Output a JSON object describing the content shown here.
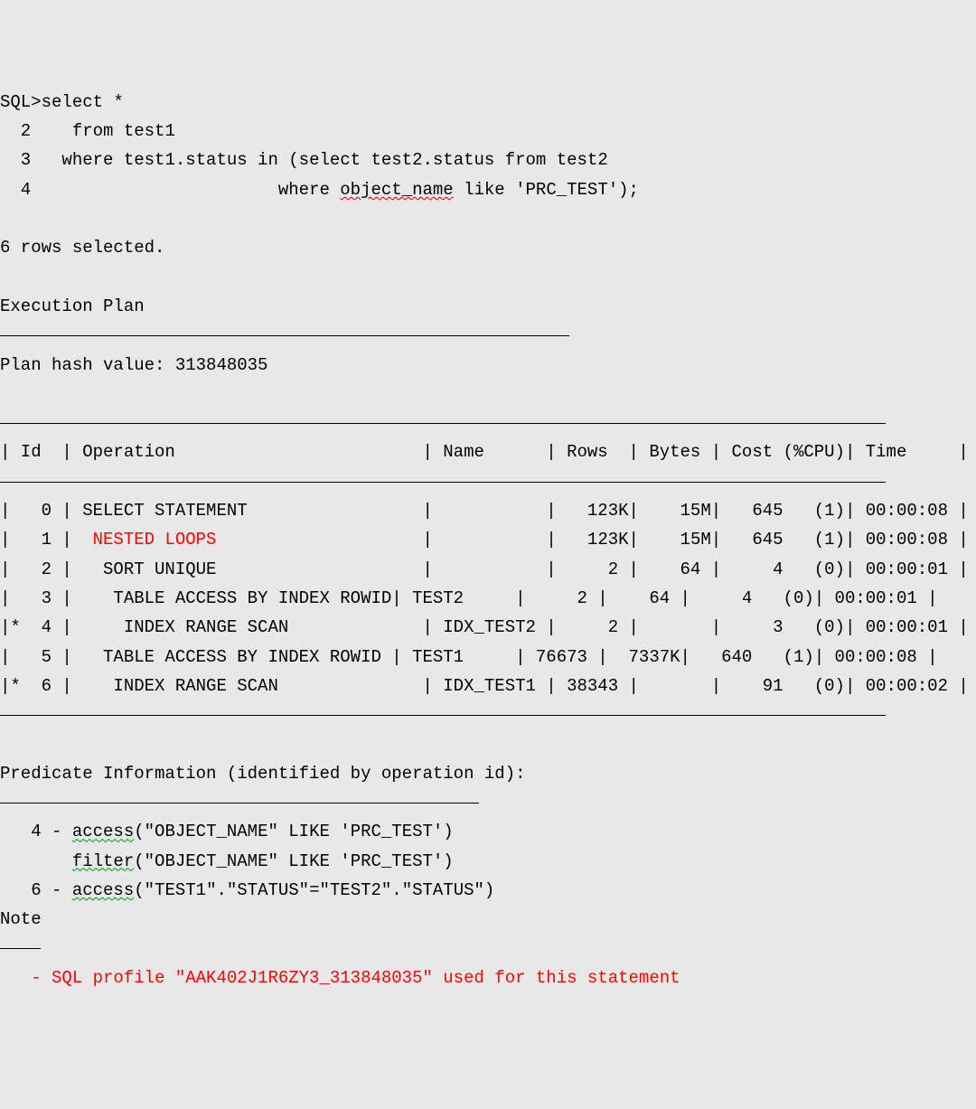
{
  "prompt": "SQL>",
  "sql": {
    "l1": "select *",
    "l2_num": "  2",
    "l2_txt": "    from test1",
    "l3_num": "  3",
    "l3_txt": "   where test1.status in (select test2.status from test2",
    "l4_num": "  4",
    "l4_txt_a": "                        where ",
    "l4_typo": "object_name",
    "l4_txt_b": " like 'PRC_TEST');"
  },
  "rows_selected": "6 rows selected.",
  "exec_plan_label": "Execution Plan",
  "plan_hash": "Plan hash value: 313848035",
  "header_row": "| Id  | Operation                        | Name      | Rows  | Bytes | Cost (%CPU)| Time     |",
  "plan_rows": {
    "r0": "|   0 | SELECT STATEMENT                 |           |   123K|    15M|   645   (1)| 00:00:08 |",
    "r1a": "|   1 |  ",
    "r1_red": "NESTED LOOPS",
    "r1b": "                    |           |   123K|    15M|   645   (1)| 00:00:08 |",
    "r2": "|   2 |   SORT UNIQUE                    |           |     2 |    64 |     4   (0)| 00:00:01 |",
    "r3": "|   3 |    TABLE ACCESS BY INDEX ROWID| TEST2     |     2 |    64 |     4   (0)| 00:00:01 |",
    "r4": "|*  4 |     INDEX RANGE SCAN             | IDX_TEST2 |     2 |       |     3   (0)| 00:00:01 |",
    "r5": "|   5 |   TABLE ACCESS BY INDEX ROWID | TEST1     | 76673 |  7337K|   640   (1)| 00:00:08 |",
    "r6": "|*  6 |    INDEX RANGE SCAN              | IDX_TEST1 | 38343 |       |    91   (0)| 00:00:02 |"
  },
  "predicate_label": "Predicate Information (identified by operation id):",
  "pred": {
    "p4a_pre": "   4 - ",
    "p4a_word": "access",
    "p4a_post": "(\"OBJECT_NAME\" LIKE 'PRC_TEST')",
    "p4b_pre": "       ",
    "p4b_word": "filter",
    "p4b_post": "(\"OBJECT_NAME\" LIKE 'PRC_TEST')",
    "p6_pre": "   6 - ",
    "p6_word": "access",
    "p6_post": "(\"TEST1\".\"STATUS\"=\"TEST2\".\"STATUS\")"
  },
  "note_label": "Note",
  "note_text": "   - SQL profile \"AAK402J1R6ZY3_313848035\" used for this statement"
}
